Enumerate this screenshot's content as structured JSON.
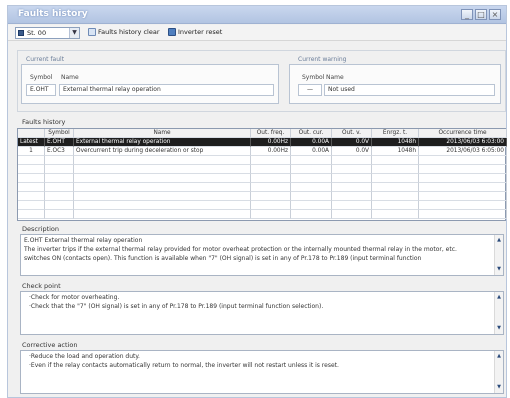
{
  "window": {
    "title": "Faults history"
  },
  "toolbar": {
    "station": "St. 00",
    "faults_clear": "Faults history clear",
    "inverter_reset": "Inverter reset"
  },
  "current_fault": {
    "group_label": "Current fault",
    "symbol_header": "Symbol",
    "name_header": "Name",
    "symbol": "E.OHT",
    "name": "External thermal relay operation"
  },
  "current_warning": {
    "group_label": "Current warning",
    "symbol_header": "Symbol",
    "name_header": "Name",
    "symbol": "—",
    "name": "Not used"
  },
  "faults_history": {
    "label": "Faults history",
    "columns": [
      "",
      "Symbol",
      "Name",
      "Out. freq.",
      "Out. cur.",
      "Out. v.",
      "Enrgz. t.",
      "Occurrence time"
    ],
    "rows": [
      [
        "Latest",
        "E.OHT",
        "External thermal relay operation",
        "0.00Hz",
        "0.00A",
        "0.0V",
        "1048h",
        "2013/06/03 6:03:00"
      ],
      [
        "1",
        "E.OC3",
        "Overcurrent trip during deceleration or stop",
        "0.00Hz",
        "0.00A",
        "0.0V",
        "1048h",
        "2013/06/03 6:05:00"
      ]
    ]
  },
  "description": {
    "label": "Description",
    "lines": [
      "E.OHT External thermal relay operation",
      "The inverter trips if the external thermal relay provided for motor overheat protection or the internally mounted thermal relay in the motor, etc.",
      "switches ON (contacts open). This function is available when \"7\" (OH signal) is set in any of Pr.178 to Pr.189 (input terminal function"
    ]
  },
  "check_point": {
    "label": "Check point",
    "lines": [
      "·Check for motor overheating.",
      "·Check that the \"7\" (OH signal) is set in any of Pr.178 to Pr.189 (input terminal function selection)."
    ]
  },
  "corrective_action": {
    "label": "Corrective action",
    "lines": [
      "·Reduce the load and operation duty.",
      "·Even if the relay contacts automatically return to normal, the inverter will not restart unless it is reset."
    ]
  },
  "colors": {
    "selected_row": "#1e1e1e",
    "title_bar": "#b8c9e6",
    "accent": "#3a5a8a"
  }
}
